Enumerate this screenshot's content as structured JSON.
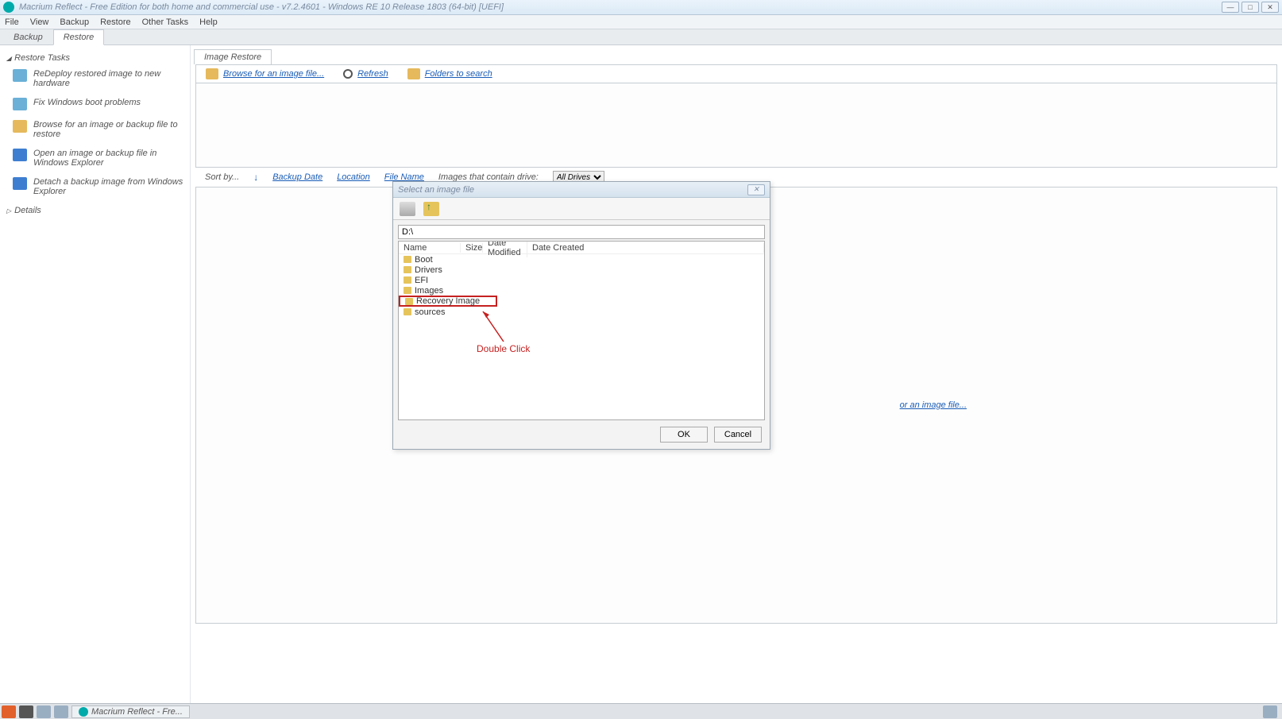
{
  "window": {
    "title": "Macrium Reflect - Free Edition for both home and commercial use - v7.2.4601 - Windows RE 10 Release 1803 (64-bit)  [UEFI]"
  },
  "menubar": [
    "File",
    "View",
    "Backup",
    "Restore",
    "Other Tasks",
    "Help"
  ],
  "maintabs": {
    "items": [
      "Backup",
      "Restore"
    ],
    "active": "Restore"
  },
  "sidebar": {
    "restore_header": "Restore Tasks",
    "items": [
      "ReDeploy restored image to new hardware",
      "Fix Windows boot problems",
      "Browse for an image or backup file to restore",
      "Open an image or backup file in Windows Explorer",
      "Detach a backup image from Windows Explorer"
    ],
    "details_header": "Details"
  },
  "content": {
    "tab": "Image Restore",
    "toolbar": {
      "browse": "Browse for an image file...",
      "refresh": "Refresh",
      "folders": "Folders to search"
    },
    "sort": {
      "label": "Sort by...",
      "backup_date": "Backup Date",
      "location": "Location",
      "file_name": "File Name",
      "drive_label": "Images that contain drive:",
      "drive_value": "All Drives"
    },
    "big_link": "or an image file..."
  },
  "dialog": {
    "title": "Select an image file",
    "path": "D:\\",
    "columns": [
      "Name",
      "Size",
      "Date Modified",
      "Date Created"
    ],
    "rows": [
      "Boot",
      "Drivers",
      "EFI",
      "Images",
      "Recovery Image",
      "sources"
    ],
    "highlighted": "Recovery Image",
    "ok": "OK",
    "cancel": "Cancel"
  },
  "annotation": {
    "text": "Double Click"
  },
  "taskbar": {
    "task": "Macrium Reflect - Fre..."
  }
}
